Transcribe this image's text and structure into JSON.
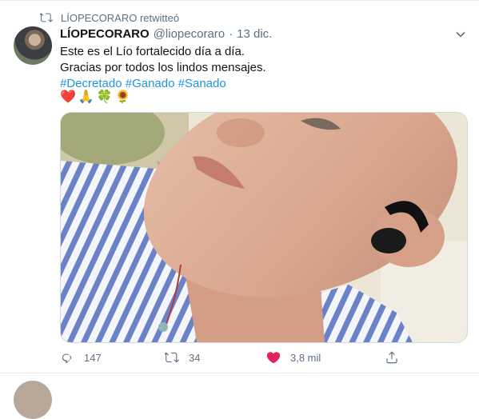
{
  "retweet": {
    "icon": "retweet-icon",
    "label": "LÍOPECORARO retwitteó"
  },
  "tweet": {
    "author_name": "LÍOPECORARO",
    "handle": "@liopecoraro",
    "separator": "·",
    "date": "13 dic.",
    "lines": [
      "Este es el Lío fortalecido día a día.",
      "Gracias por todos los lindos mensajes."
    ],
    "hashtags": [
      "#Decretado",
      "#Ganado",
      "#Sanado"
    ],
    "emojis": [
      "❤️",
      "🙏",
      "🍀",
      "🌻"
    ]
  },
  "actions": {
    "reply": {
      "icon": "reply-icon",
      "count": "147"
    },
    "retweet": {
      "icon": "retweet-icon",
      "count": "34"
    },
    "like": {
      "icon": "heart-icon",
      "count": "3,8 mil",
      "color": "#e0245e"
    },
    "share": {
      "icon": "share-icon"
    }
  },
  "colors": {
    "link": "#1b95e0",
    "muted": "#5b7083",
    "text": "#0f1419"
  }
}
